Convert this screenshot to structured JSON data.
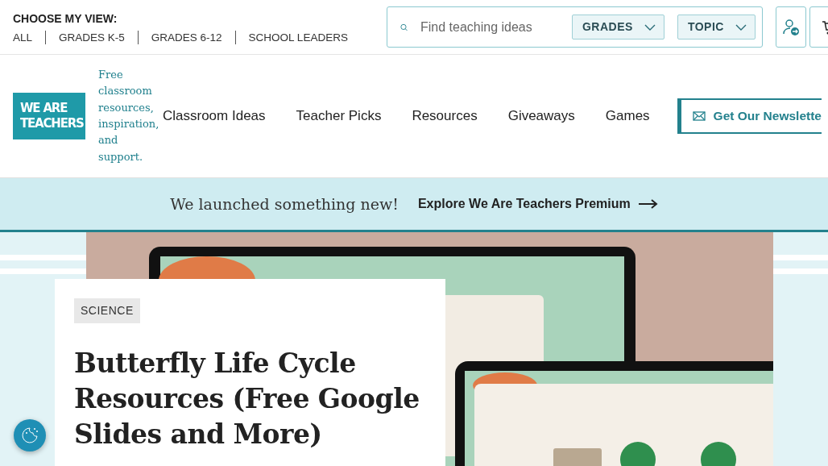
{
  "view_chooser": {
    "label": "CHOOSE MY VIEW:",
    "options": [
      {
        "label": "ALL"
      },
      {
        "label": "GRADES K-5"
      },
      {
        "label": "GRADES 6-12"
      },
      {
        "label": "SCHOOL LEADERS"
      }
    ]
  },
  "search": {
    "placeholder": "Find teaching ideas",
    "filters": [
      {
        "label": "GRADES"
      },
      {
        "label": "TOPIC"
      }
    ]
  },
  "logo": {
    "line_1": "WE ARE",
    "line_2": "TEACHERS"
  },
  "tagline": "Free classroom resources, inspiration, and support.",
  "nav": [
    {
      "label": "Classroom Ideas"
    },
    {
      "label": "Teacher Picks"
    },
    {
      "label": "Resources"
    },
    {
      "label": "Giveaways"
    },
    {
      "label": "Games"
    }
  ],
  "newsletter_button": "Get Our Newslette",
  "banner": {
    "message": "We launched something new!",
    "link": "Explore We Are Teachers Premium"
  },
  "article": {
    "tag": "SCIENCE",
    "title": "Butterfly Life Cycle Resources (Free Google Slides and More)"
  }
}
